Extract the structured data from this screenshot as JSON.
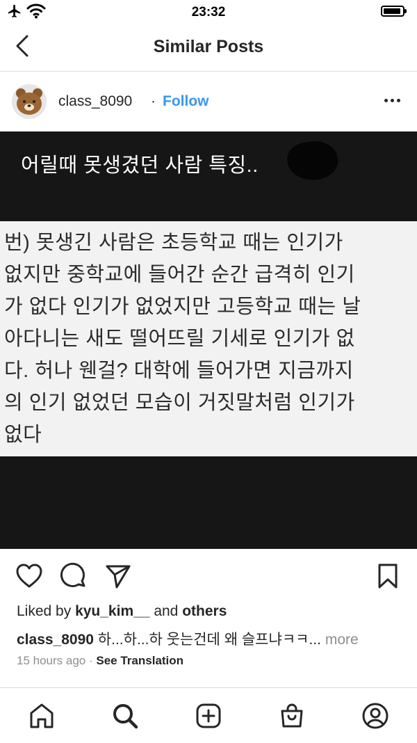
{
  "status_bar": {
    "time": "23:32",
    "icons": [
      "airplane-icon",
      "wifi-icon",
      "battery-icon"
    ]
  },
  "header": {
    "title": "Similar Posts",
    "back_icon": "chevron-left-icon"
  },
  "post": {
    "username": "class_8090",
    "separator": "·",
    "follow_label": "Follow",
    "image": {
      "title": "어릴때 못생겼던 사람 특징..",
      "body_lines": [
        "번) 못생긴 사람은 초등학교 때는 인기가",
        "없지만 중학교에 들어간 순간 급격히 인기",
        "가 없다 인기가 없었지만 고등학교 때는 날",
        "아다니는 새도 떨어뜨릴 기세로 인기가 없",
        "다. 허나 웬걸? 대학에 들어가면 지금까지",
        "의 인기 없었던 모습이 거짓말처럼 인기가",
        "없다"
      ]
    },
    "likes": {
      "prefix": "Liked by",
      "user": "kyu_kim__",
      "conj": "and",
      "others": "others"
    },
    "caption": {
      "username": "class_8090",
      "text": "하...하...하 웃는건데 왜 슬프냐ㅋㅋ...",
      "more": "more"
    },
    "timestamp": "15 hours ago",
    "meta_separator": "·",
    "see_translation": "See Translation"
  },
  "tab_bar": [
    "home-icon",
    "search-icon",
    "add-post-icon",
    "shop-icon",
    "profile-icon"
  ],
  "colors": {
    "link": "#3897f0",
    "text": "#262626",
    "muted": "#8e8e8e",
    "image_bg": "#161616",
    "panel_bg": "#f2f2f2"
  }
}
